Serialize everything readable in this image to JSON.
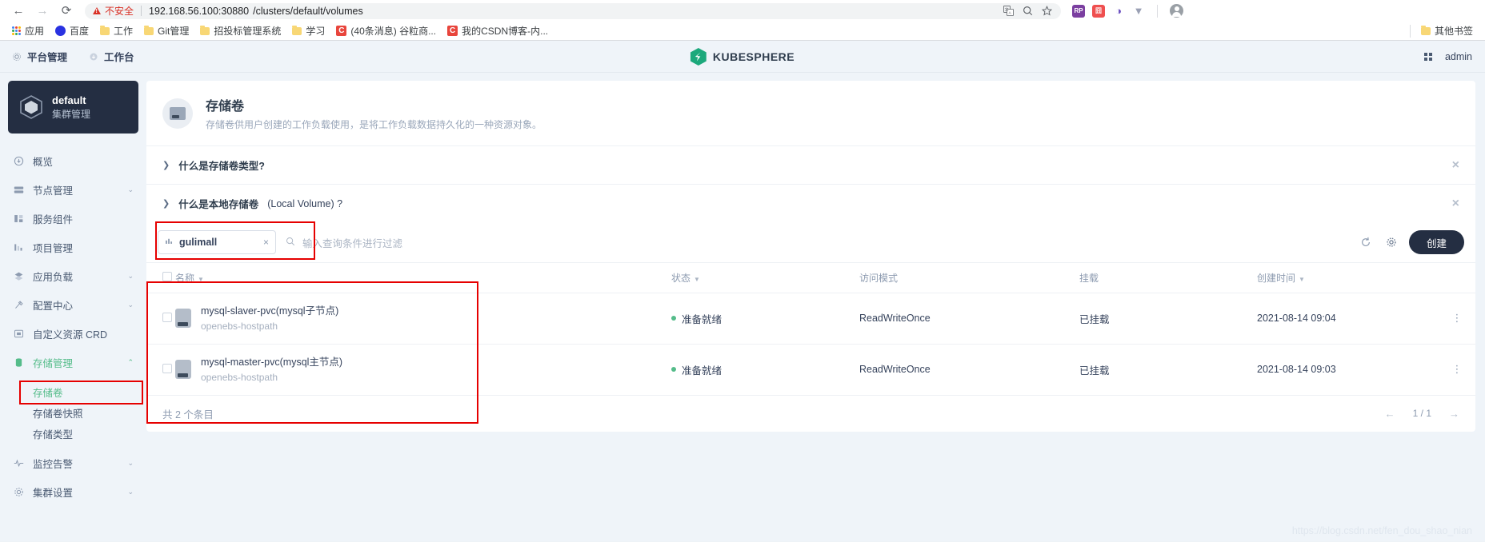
{
  "browser": {
    "back_icon": "←",
    "forward_icon": "→",
    "reload_icon": "⟳",
    "security_label": "不安全",
    "url_host": "192.168.56.100:30880",
    "url_path": "/clusters/default/volumes",
    "translate_icon": "translate-icon",
    "zoom_icon": "search-icon",
    "bookmark_icon": "star-icon",
    "profile_icon": "profile-icon",
    "extensions": [
      {
        "name": "axure-extension",
        "label": "RP",
        "color": "#7b3fa0"
      },
      {
        "name": "red-extension",
        "label": "囧",
        "color": "#ef4f4f"
      },
      {
        "name": "opera-extension",
        "label": "O",
        "color": "#ffffff"
      },
      {
        "name": "v-extension",
        "label": "V",
        "color": "#ffffff"
      }
    ],
    "bookmarks": [
      {
        "name": "apps",
        "label": "应用",
        "icon": "apps-grid-icon"
      },
      {
        "name": "baidu",
        "label": "百度",
        "icon": "baidu-icon"
      },
      {
        "name": "work",
        "label": "工作",
        "icon": "folder-icon"
      },
      {
        "name": "git",
        "label": "Git管理",
        "icon": "folder-icon"
      },
      {
        "name": "bidding",
        "label": "招投标管理系统",
        "icon": "folder-icon"
      },
      {
        "name": "study",
        "label": "学习",
        "icon": "folder-icon"
      },
      {
        "name": "csdn-msg",
        "label": "(40条消息) 谷粒商...",
        "icon": "csdn-icon"
      },
      {
        "name": "csdn-blog",
        "label": "我的CSDN博客-内...",
        "icon": "csdn-icon"
      }
    ],
    "other_bookmarks": "其他书签"
  },
  "topbar": {
    "platform_label": "平台管理",
    "workbench_label": "工作台",
    "logo_text": "KUBESPHERE",
    "user_label": "admin"
  },
  "sidebar": {
    "cluster_name": "default",
    "cluster_sub": "集群管理",
    "items": [
      {
        "label": "概览",
        "icon": "overview-icon",
        "expandable": false,
        "active": false
      },
      {
        "label": "节点管理",
        "icon": "node-icon",
        "expandable": true,
        "active": false
      },
      {
        "label": "服务组件",
        "icon": "components-icon",
        "expandable": false,
        "active": false
      },
      {
        "label": "项目管理",
        "icon": "project-icon",
        "expandable": false,
        "active": false
      },
      {
        "label": "应用负载",
        "icon": "workload-icon",
        "expandable": true,
        "active": false
      },
      {
        "label": "配置中心",
        "icon": "config-icon",
        "expandable": true,
        "active": false
      },
      {
        "label": "自定义资源 CRD",
        "icon": "crd-icon",
        "expandable": false,
        "active": false
      },
      {
        "label": "存储管理",
        "icon": "storage-icon",
        "expandable": true,
        "active": true
      }
    ],
    "storage_children": [
      {
        "label": "存储卷",
        "active": true
      },
      {
        "label": "存储卷快照",
        "active": false
      },
      {
        "label": "存储类型",
        "active": false
      }
    ],
    "items_after": [
      {
        "label": "监控告警",
        "icon": "monitor-icon",
        "expandable": true,
        "active": false
      },
      {
        "label": "集群设置",
        "icon": "settings-icon",
        "expandable": true,
        "active": false
      }
    ]
  },
  "page": {
    "title": "存储卷",
    "description": "存储卷供用户创建的工作负载使用，是将工作负载数据持久化的一种资源对象。",
    "icon": "volume-icon",
    "faq": [
      {
        "label": "什么是存储卷类型?",
        "suffix": ""
      },
      {
        "label": "什么是本地存储卷",
        "suffix": " (Local Volume) ?"
      }
    ]
  },
  "toolbar": {
    "filter_chip_value": "gulimall",
    "filter_chip_icon": "filter-icon",
    "clear_icon": "×",
    "search_placeholder": "输入查询条件进行过滤",
    "search_icon": "search-icon",
    "refresh_icon": "refresh-icon",
    "settings_icon": "gear-icon",
    "create_label": "创建"
  },
  "table": {
    "columns": [
      {
        "key": "name",
        "label": "名称",
        "sortable": true
      },
      {
        "key": "status",
        "label": "状态",
        "sortable": true
      },
      {
        "key": "access",
        "label": "访问模式",
        "sortable": false
      },
      {
        "key": "mount",
        "label": "挂载",
        "sortable": false
      },
      {
        "key": "created",
        "label": "创建时间",
        "sortable": true
      }
    ],
    "rows": [
      {
        "name": "mysql-slaver-pvc(mysql子节点)",
        "sub": "openebs-hostpath",
        "status": "准备就绪",
        "status_color": "#55bc8a",
        "access": "ReadWriteOnce",
        "mount": "已挂载",
        "created": "2021-08-14 09:04"
      },
      {
        "name": "mysql-master-pvc(mysql主节点)",
        "sub": "openebs-hostpath",
        "status": "准备就绪",
        "status_color": "#55bc8a",
        "access": "ReadWriteOnce",
        "mount": "已挂载",
        "created": "2021-08-14 09:03"
      }
    ],
    "footer_count": "共 2 个条目",
    "page_indicator": "1 / 1",
    "prev_icon": "←",
    "next_icon": "→"
  },
  "watermark": "https://blog.csdn.net/fen_dou_shao_nian"
}
